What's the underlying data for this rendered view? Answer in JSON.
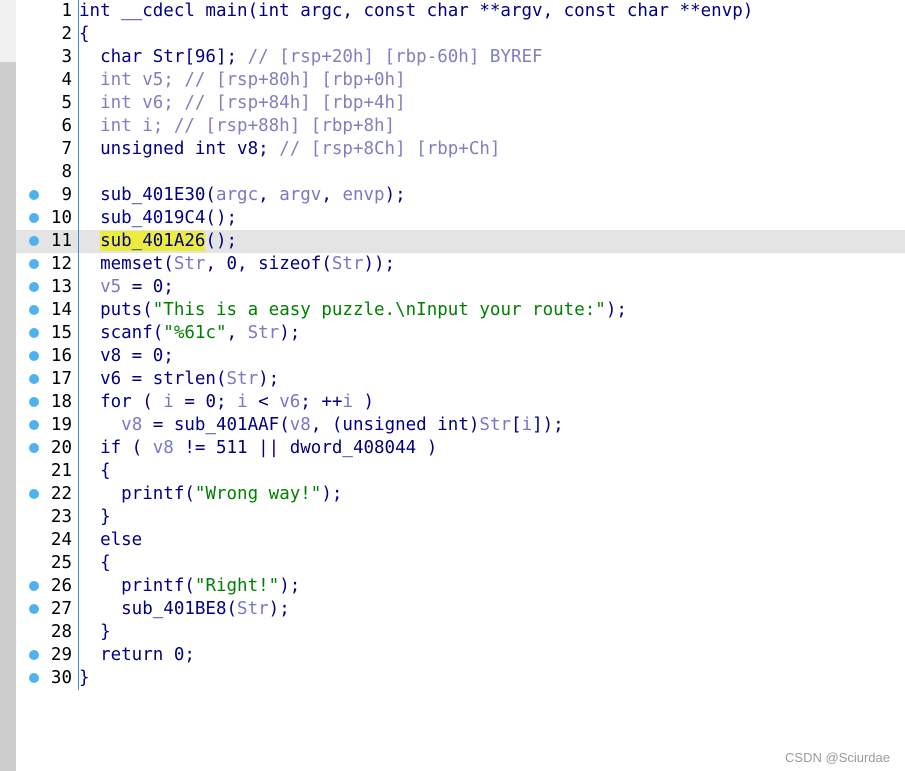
{
  "editor": {
    "current_line": 11,
    "lines": [
      {
        "n": "1",
        "bp": false,
        "tokens": [
          {
            "t": "int __cdecl main(int argc, const char **argv, const char **envp)",
            "c": "kw"
          }
        ]
      },
      {
        "n": "2",
        "bp": false,
        "tokens": [
          {
            "t": "{",
            "c": "kw"
          }
        ]
      },
      {
        "n": "3",
        "bp": false,
        "tokens": [
          {
            "t": "  char Str[96]; ",
            "c": "kw"
          },
          {
            "t": "// [rsp+20h] [rbp-60h] BYREF",
            "c": "cm"
          }
        ]
      },
      {
        "n": "4",
        "bp": false,
        "tokens": [
          {
            "t": "  int v5; ",
            "c": "cm"
          },
          {
            "t": "// [rsp+80h] [rbp+0h]",
            "c": "cm"
          }
        ]
      },
      {
        "n": "5",
        "bp": false,
        "tokens": [
          {
            "t": "  int v6; ",
            "c": "cm"
          },
          {
            "t": "// [rsp+84h] [rbp+4h]",
            "c": "cm"
          }
        ]
      },
      {
        "n": "6",
        "bp": false,
        "tokens": [
          {
            "t": "  int i; ",
            "c": "cm"
          },
          {
            "t": "// [rsp+88h] [rbp+8h]",
            "c": "cm"
          }
        ]
      },
      {
        "n": "7",
        "bp": false,
        "tokens": [
          {
            "t": "  unsigned int v8; ",
            "c": "kw"
          },
          {
            "t": "// [rsp+8Ch] [rbp+Ch]",
            "c": "cm"
          }
        ]
      },
      {
        "n": "8",
        "bp": false,
        "tokens": [
          {
            "t": "",
            "c": "kw"
          }
        ]
      },
      {
        "n": "9",
        "bp": true,
        "tokens": [
          {
            "t": "  sub_401E30(",
            "c": "fn"
          },
          {
            "t": "argc",
            "c": "var"
          },
          {
            "t": ", ",
            "c": "fn"
          },
          {
            "t": "argv",
            "c": "var"
          },
          {
            "t": ", ",
            "c": "fn"
          },
          {
            "t": "envp",
            "c": "var"
          },
          {
            "t": ");",
            "c": "fn"
          }
        ]
      },
      {
        "n": "10",
        "bp": true,
        "tokens": [
          {
            "t": "  sub_4019C4();",
            "c": "fn"
          }
        ]
      },
      {
        "n": "11",
        "bp": true,
        "tokens": [
          {
            "t": "  ",
            "c": "fn"
          },
          {
            "t": "sub_401A26",
            "c": "hl"
          },
          {
            "t": "();",
            "c": "fn"
          }
        ]
      },
      {
        "n": "12",
        "bp": true,
        "tokens": [
          {
            "t": "  memset(",
            "c": "fn"
          },
          {
            "t": "Str",
            "c": "var"
          },
          {
            "t": ", 0, sizeof(",
            "c": "fn"
          },
          {
            "t": "Str",
            "c": "var"
          },
          {
            "t": "));",
            "c": "fn"
          }
        ]
      },
      {
        "n": "13",
        "bp": true,
        "tokens": [
          {
            "t": "  ",
            "c": "fn"
          },
          {
            "t": "v5",
            "c": "var"
          },
          {
            "t": " = 0;",
            "c": "fn"
          }
        ]
      },
      {
        "n": "14",
        "bp": true,
        "tokens": [
          {
            "t": "  puts(",
            "c": "fn"
          },
          {
            "t": "\"This is a easy puzzle.\\nInput your route:\"",
            "c": "str"
          },
          {
            "t": ");",
            "c": "fn"
          }
        ]
      },
      {
        "n": "15",
        "bp": true,
        "tokens": [
          {
            "t": "  scanf(",
            "c": "fn"
          },
          {
            "t": "\"%61c\"",
            "c": "str"
          },
          {
            "t": ", ",
            "c": "fn"
          },
          {
            "t": "Str",
            "c": "var"
          },
          {
            "t": ");",
            "c": "fn"
          }
        ]
      },
      {
        "n": "16",
        "bp": true,
        "tokens": [
          {
            "t": "  v8 = 0;",
            "c": "fn"
          }
        ]
      },
      {
        "n": "17",
        "bp": true,
        "tokens": [
          {
            "t": "  v6 = strlen(",
            "c": "fn"
          },
          {
            "t": "Str",
            "c": "var"
          },
          {
            "t": ");",
            "c": "fn"
          }
        ]
      },
      {
        "n": "18",
        "bp": true,
        "tokens": [
          {
            "t": "  for ( ",
            "c": "fn"
          },
          {
            "t": "i",
            "c": "var"
          },
          {
            "t": " = 0; ",
            "c": "fn"
          },
          {
            "t": "i",
            "c": "var"
          },
          {
            "t": " < ",
            "c": "fn"
          },
          {
            "t": "v6",
            "c": "var"
          },
          {
            "t": "; ++",
            "c": "fn"
          },
          {
            "t": "i",
            "c": "var"
          },
          {
            "t": " )",
            "c": "fn"
          }
        ]
      },
      {
        "n": "19",
        "bp": true,
        "tokens": [
          {
            "t": "    ",
            "c": "fn"
          },
          {
            "t": "v8",
            "c": "var"
          },
          {
            "t": " = sub_401AAF(",
            "c": "fn"
          },
          {
            "t": "v8",
            "c": "var"
          },
          {
            "t": ", (unsigned int)",
            "c": "fn"
          },
          {
            "t": "Str",
            "c": "var"
          },
          {
            "t": "[",
            "c": "fn"
          },
          {
            "t": "i",
            "c": "var"
          },
          {
            "t": "]);",
            "c": "fn"
          }
        ]
      },
      {
        "n": "20",
        "bp": true,
        "tokens": [
          {
            "t": "  if ( ",
            "c": "fn"
          },
          {
            "t": "v8",
            "c": "var"
          },
          {
            "t": " != 511 || dword_408044 )",
            "c": "fn"
          }
        ]
      },
      {
        "n": "21",
        "bp": false,
        "tokens": [
          {
            "t": "  {",
            "c": "fn"
          }
        ]
      },
      {
        "n": "22",
        "bp": true,
        "tokens": [
          {
            "t": "    printf(",
            "c": "fn"
          },
          {
            "t": "\"Wrong way!\"",
            "c": "str"
          },
          {
            "t": ");",
            "c": "fn"
          }
        ]
      },
      {
        "n": "23",
        "bp": false,
        "tokens": [
          {
            "t": "  }",
            "c": "fn"
          }
        ]
      },
      {
        "n": "24",
        "bp": false,
        "tokens": [
          {
            "t": "  else",
            "c": "fn"
          }
        ]
      },
      {
        "n": "25",
        "bp": false,
        "tokens": [
          {
            "t": "  {",
            "c": "fn"
          }
        ]
      },
      {
        "n": "26",
        "bp": true,
        "tokens": [
          {
            "t": "    printf(",
            "c": "fn"
          },
          {
            "t": "\"Right!\"",
            "c": "str"
          },
          {
            "t": ");",
            "c": "fn"
          }
        ]
      },
      {
        "n": "27",
        "bp": true,
        "tokens": [
          {
            "t": "    sub_401BE8(",
            "c": "fn"
          },
          {
            "t": "Str",
            "c": "var"
          },
          {
            "t": ");",
            "c": "fn"
          }
        ]
      },
      {
        "n": "28",
        "bp": false,
        "tokens": [
          {
            "t": "  }",
            "c": "fn"
          }
        ]
      },
      {
        "n": "29",
        "bp": true,
        "tokens": [
          {
            "t": "  return 0;",
            "c": "fn"
          }
        ]
      },
      {
        "n": "30",
        "bp": true,
        "tokens": [
          {
            "t": "}",
            "c": "fn"
          }
        ]
      }
    ]
  },
  "watermark": "CSDN @Sciurdae",
  "colors": {
    "keyword": "#000080",
    "variable": "#7878c8",
    "string": "#008000",
    "comment": "#8080c0",
    "highlight": "#ecec3c",
    "breakpoint_dot": "#4fb2f0",
    "current_line_bg": "#e4e4e4"
  }
}
